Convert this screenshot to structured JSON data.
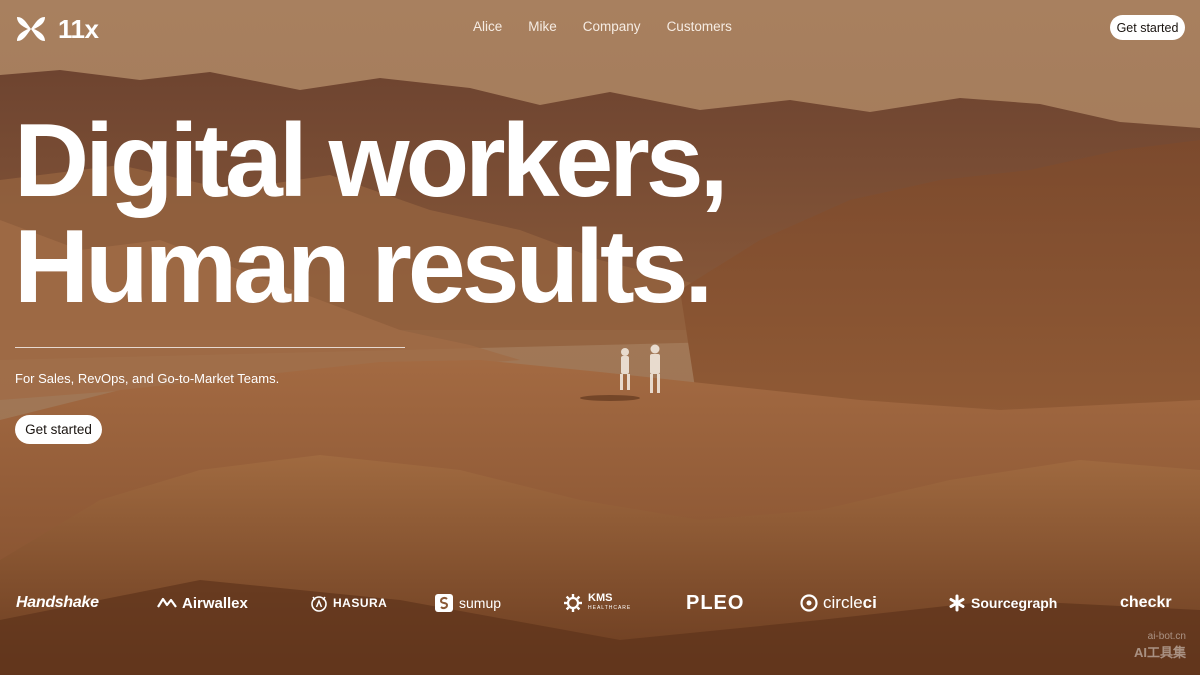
{
  "brand": {
    "name": "11x"
  },
  "nav": {
    "links": [
      "Alice",
      "Mike",
      "Company",
      "Customers"
    ],
    "cta_label": "Get started"
  },
  "hero": {
    "headline_line1": "Digital workers,",
    "headline_line2": "Human results.",
    "subtitle": "For Sales, RevOps, and Go-to-Market Teams.",
    "cta_label": "Get started"
  },
  "customers": {
    "logos": [
      {
        "name": "Handshake",
        "text": "Handshake",
        "icon": "none"
      },
      {
        "name": "Airwallex",
        "text": "Airwallex",
        "icon": "airwallex-icon"
      },
      {
        "name": "Hasura",
        "text": "HASURA",
        "icon": "hasura-icon"
      },
      {
        "name": "SumUp",
        "text": "sumup",
        "icon": "sumup-icon"
      },
      {
        "name": "KMS Healthcare",
        "text": "KMS",
        "sub": "HEALTHCARE",
        "icon": "gear-icon"
      },
      {
        "name": "Pleo",
        "text": "PLEO",
        "icon": "none"
      },
      {
        "name": "CircleCI",
        "text_a": "circle",
        "text_b": "ci",
        "icon": "circleci-icon"
      },
      {
        "name": "Sourcegraph",
        "text": "Sourcegraph",
        "icon": "asterisk-icon"
      },
      {
        "name": "Checkr",
        "text": "checkr",
        "icon": "none"
      }
    ]
  },
  "watermark": {
    "line1": "ai-bot.cn",
    "line2": "AI工具集"
  },
  "colors": {
    "background": "#8a5a38",
    "text": "#ffffff",
    "button_bg": "#ffffff",
    "button_text": "#1a1410"
  }
}
